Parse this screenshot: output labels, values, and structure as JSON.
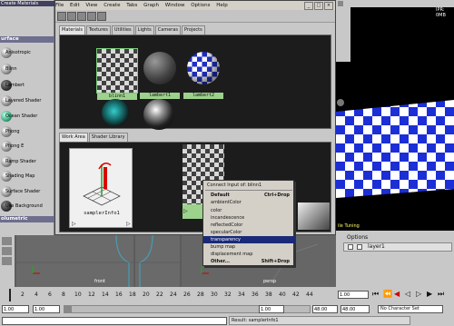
{
  "app": {
    "hypershade_menu": [
      "File",
      "Edit",
      "View",
      "Create",
      "Tabs",
      "Graph",
      "Window",
      "Options",
      "Help"
    ]
  },
  "left_panel": {
    "title": "Create Materials",
    "category_surface": "urface",
    "category_volumetric": "olumetric",
    "items": [
      "Anisotropic",
      "Blinn",
      "Lambert",
      "Layered Shader",
      "Ocean Shader",
      "Phong",
      "Phong E",
      "Ramp Shader",
      "Shading Map",
      "Surface Shader",
      "Use Background"
    ]
  },
  "top_tabs": [
    "Materials",
    "Textures",
    "Utilities",
    "Lights",
    "Cameras",
    "Projects"
  ],
  "swatches": [
    "blinn1",
    "lambert1",
    "lambert2"
  ],
  "work_tabs": [
    "Work Area",
    "Shader Library"
  ],
  "work_node": "samplerInfo1",
  "context_menu": {
    "title": "Connect Input of: blinn1",
    "default_label": "Default",
    "default_shortcut": "Ctrl+Drop",
    "items": [
      "ambientColor",
      "color",
      "incandescence",
      "reflectedColor",
      "specularColor"
    ],
    "selected": "transparency",
    "items_after": [
      "bump map",
      "displacement map"
    ],
    "other_label": "Other...",
    "other_shortcut": "Shift+Drop"
  },
  "viewport": {
    "panel_label": "IPR: 0MB",
    "render_text": "ile Tuning"
  },
  "layers": {
    "menu": "Options",
    "layer_name": "layer1"
  },
  "graph": {
    "front_label": "front",
    "persp_label": "persp"
  },
  "timeline": {
    "ticks": [
      "2",
      "4",
      "6",
      "8",
      "10",
      "12",
      "14",
      "16",
      "18",
      "20",
      "22",
      "24",
      "26",
      "28",
      "30",
      "32",
      "34",
      "36",
      "38",
      "40",
      "42",
      "44"
    ],
    "current_frame": "1.00"
  },
  "range": {
    "start": "1.00",
    "field2": "1.00",
    "field3": "1.00",
    "end_field": "48.00",
    "end_field2": "48.00",
    "character_set": "No Character Set"
  },
  "status": {
    "result": "Result: samplerInfo1"
  }
}
